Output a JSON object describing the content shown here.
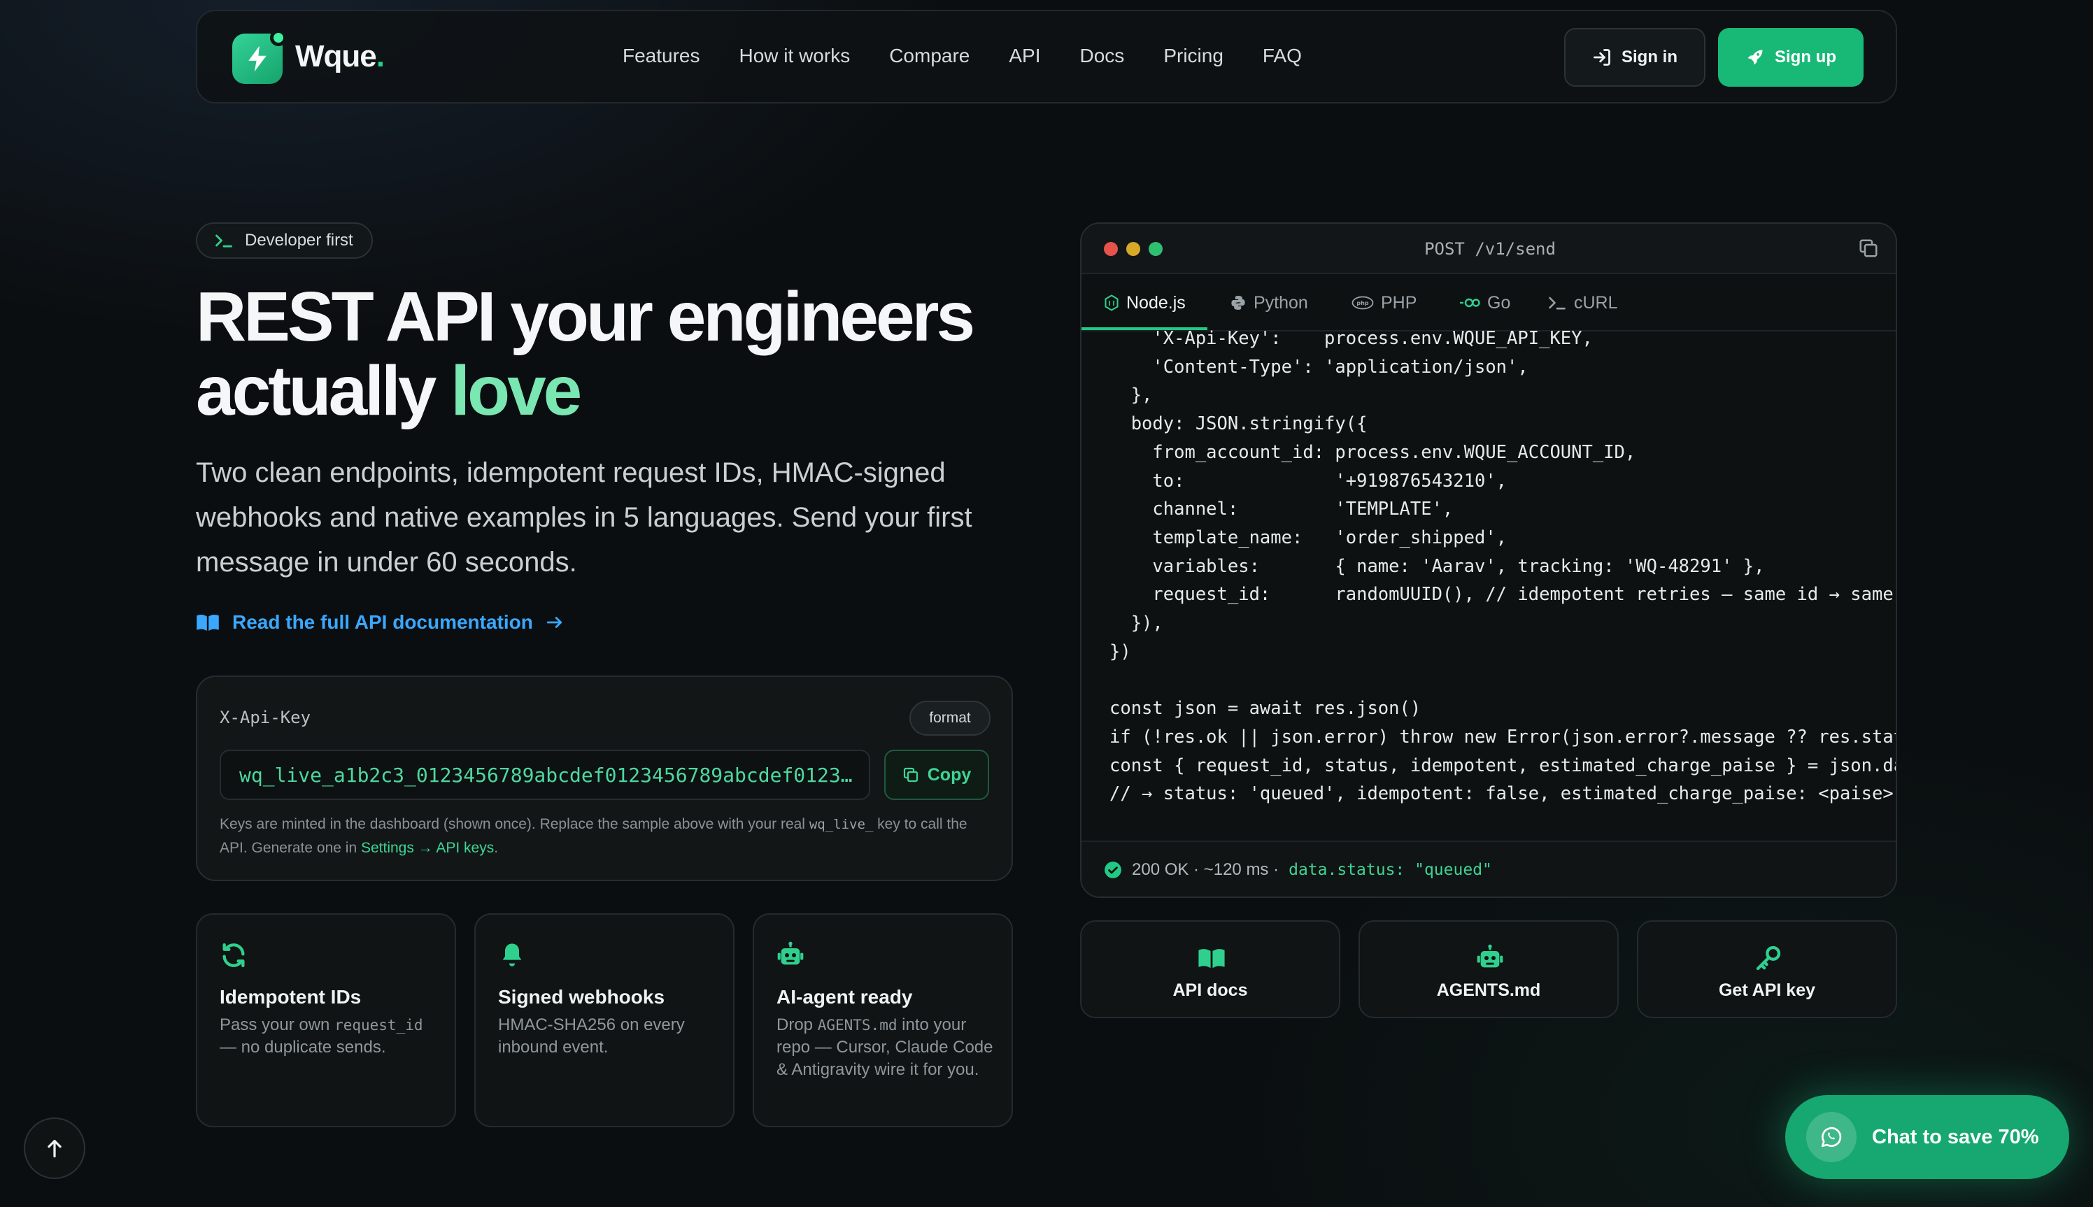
{
  "nav": {
    "brand": "Wque",
    "brand_dot": ".",
    "links": [
      "Features",
      "How it works",
      "Compare",
      "API",
      "Docs",
      "Pricing",
      "FAQ"
    ],
    "signin_label": "Sign in",
    "signup_label": "Sign up"
  },
  "hero": {
    "badge": "Developer first",
    "title_line1": "REST API your engineers",
    "title_line2_a": "actually ",
    "title_line2_b": "love",
    "subtitle": "Two clean endpoints, idempotent request IDs, HMAC-signed webhooks and native examples in 5 languages. Send your first message in under 60 seconds.",
    "doc_link": "Read the full API documentation"
  },
  "key_card": {
    "label": "X-Api-Key",
    "format_label": "format",
    "key_value": "wq_live_a1b2c3_0123456789abcdef0123456789abcdef0123…",
    "copy_label": "Copy",
    "note_a": "Keys are minted in the dashboard (shown once). Replace the sample above with your real ",
    "note_code": "wq_live_",
    "note_b": " key to call the API. Generate one in ",
    "note_link": "Settings → API keys",
    "note_end": "."
  },
  "features": [
    {
      "title": "Idempotent IDs",
      "desc_a": "Pass your own ",
      "desc_code": "request_id",
      "desc_b": " — no duplicate sends."
    },
    {
      "title": "Signed webhooks",
      "desc": "HMAC-SHA256 on every inbound event."
    },
    {
      "title": "AI-agent ready",
      "desc_a": "Drop ",
      "desc_code": "AGENTS.md",
      "desc_b": " into your repo — Cursor, Claude Code & Antigravity wire it for you."
    }
  ],
  "code_window": {
    "title": "POST /v1/send",
    "tabs": [
      "Node.js",
      "Python",
      "PHP",
      "Go",
      "cURL"
    ],
    "active_tab": "Node.js",
    "code": "    'X-Api-Key':    process.env.WQUE_API_KEY,\n    'Content-Type': 'application/json',\n  },\n  body: JSON.stringify({\n    from_account_id: process.env.WQUE_ACCOUNT_ID,\n    to:              '+919876543210',\n    channel:         'TEMPLATE',\n    template_name:   'order_shipped',\n    variables:       { name: 'Aarav', tracking: 'WQ-48291' },\n    request_id:      randomUUID(), // idempotent retries — same id → same s\n  }),\n})\n\nconst json = await res.json()\nif (!res.ok || json.error) throw new Error(json.error?.message ?? res.statu\nconst { request_id, status, idempotent, estimated_charge_paise } = json.dat\n// → status: 'queued', idempotent: false, estimated_charge_paise: <paise>",
    "status_text": "200 OK · ~120 ms ·",
    "status_code": "data.status: \"queued\""
  },
  "quick_links": [
    "API docs",
    "AGENTS.md",
    "Get API key"
  ],
  "chat_button": "Chat to save 70%",
  "icons": {
    "logo": "bolt-icon",
    "signin": "login-icon",
    "signup": "rocket-icon",
    "badge": "terminal-icon",
    "doc_link": "book-icon",
    "copy": "copy-icon",
    "features": [
      "refresh-icon",
      "bell-icon",
      "robot-icon"
    ],
    "quick_links": [
      "book-icon",
      "robot-icon",
      "key-icon"
    ],
    "scroll_top": "arrow-up-icon",
    "chat": "whatsapp-icon"
  },
  "colors": {
    "accent": "#18b877",
    "link": "#3aa8ff",
    "key_text": "#4fd7a0",
    "traffic_red": "#e5534b",
    "traffic_yellow": "#d6a928",
    "traffic_green": "#2fbf71"
  }
}
